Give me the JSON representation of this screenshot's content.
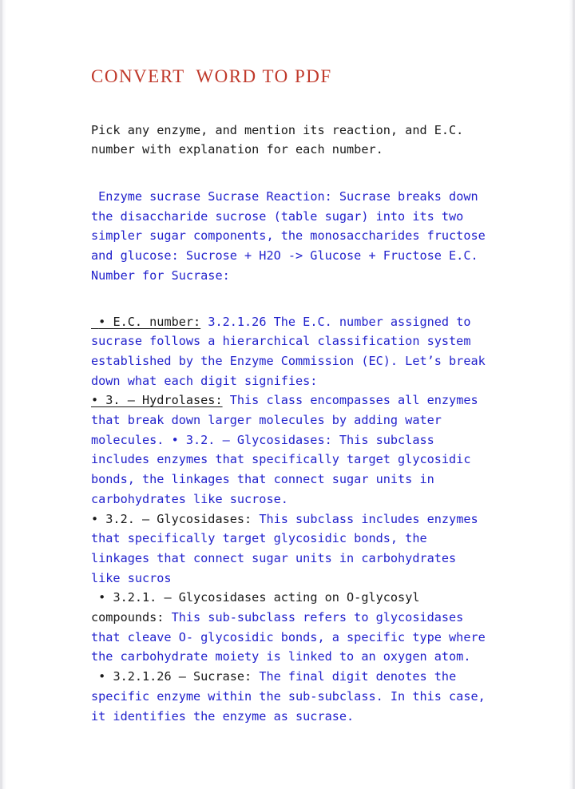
{
  "document": {
    "title": "CONVERT  WORD TO PDF",
    "colors": {
      "title": "#c0392b",
      "body_black": "#1a1a1a",
      "body_blue": "#2222cc",
      "page_background": "#ffffff"
    },
    "paragraphs": {
      "intro": {
        "text": "Pick any enzyme, and mention its reaction, and E.C. number with explanation for each number.",
        "color": "black"
      },
      "enzyme_reaction": {
        "text": " Enzyme sucrase Sucrase Reaction: Sucrase breaks down the disaccharide sucrose (table sugar) into its two simpler sugar components, the monosaccharides fructose and glucose: Sucrose + H2O -> Glucose + Fructose E.C. Number for Sucrase:",
        "color": "blue"
      },
      "ec_number": {
        "label": " • E.C. number:",
        "label_style": "black-underlined",
        "body": " 3.2.1.26 The E.C. number assigned to sucrase follows a hierarchical classification system established by the Enzyme Commission (EC). Let’s break down what each digit signifies:",
        "body_color": "blue"
      },
      "hydrolases": {
        "label": "• 3. – Hydrolases:",
        "label_style": "black-underlined",
        "body": " This class encompasses all enzymes that break down larger molecules by adding water molecules. • 3.2. – Glycosidases: This subclass includes enzymes that specifically target glycosidic bonds, the linkages that connect sugar units in carbohydrates like sucrose.",
        "body_color": "blue"
      },
      "glycosidases_2": {
        "label": "• 3.2. – Glycosidases:",
        "label_style": "black",
        "body": " This subclass includes enzymes that specifically target glycosidic bonds, the linkages that connect sugar units in carbohydrates like sucros",
        "body_color": "blue"
      },
      "glycosidases_3": {
        "label": " • 3.2.1. – Glycosidases acting on O-glycosyl compounds:",
        "label_style": "black",
        "body": " This sub-subclass refers to glycosidases that cleave O- glycosidic bonds, a specific type where the carbohydrate moiety is linked to an oxygen atom.",
        "body_color": "blue"
      },
      "sucrase": {
        "label": " • 3.2.1.26 – Sucrase:",
        "label_style": "black",
        "body": " The final digit denotes the specific enzyme within the sub-subclass. In this case, it identifies the enzyme as sucrase.",
        "body_color": "blue"
      }
    }
  }
}
